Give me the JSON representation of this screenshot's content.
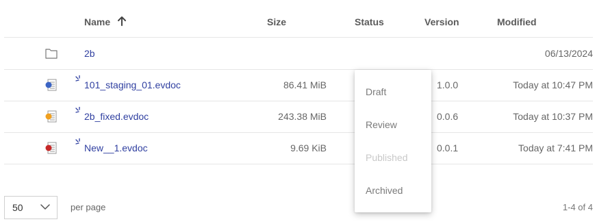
{
  "table": {
    "columns": {
      "name": "Name",
      "size": "Size",
      "status": "Status",
      "version": "Version",
      "modified": "Modified"
    },
    "rows": [
      {
        "name": "2b",
        "type": "folder",
        "size": "",
        "version": "",
        "modified": "06/13/2024"
      },
      {
        "name": "101_staging_01.evdoc",
        "type": "doc-blue",
        "size": "86.41 MiB",
        "version": "1.0.0",
        "modified": "Today at 10:47 PM"
      },
      {
        "name": "2b_fixed.evdoc",
        "type": "doc-orange",
        "size": "243.38 MiB",
        "version": "0.0.6",
        "modified": "Today at 10:37 PM"
      },
      {
        "name": "New__1.evdoc",
        "type": "doc-red",
        "size": "9.69 KiB",
        "version": "0.0.1",
        "modified": "Today at 7:41 PM"
      }
    ]
  },
  "status_menu": {
    "items": [
      {
        "label": "Draft",
        "enabled": true
      },
      {
        "label": "Review",
        "enabled": true
      },
      {
        "label": "Published",
        "enabled": false
      },
      {
        "label": "Archived",
        "enabled": true
      }
    ]
  },
  "pagination": {
    "per_page_value": "50",
    "per_page_label": "per page",
    "range": "1-4 of 4"
  },
  "colors": {
    "link": "#2f3fa0",
    "doc_blue": "#3b64c4",
    "doc_orange": "#f0a020",
    "doc_red": "#c62828",
    "spinner": "#2f3fa0"
  },
  "icons": {
    "sort": "arrow-up-icon",
    "folder": "folder-icon",
    "doc": "document-icon",
    "spinner": "loading-spinner-icon",
    "chevron": "chevron-down-icon"
  }
}
